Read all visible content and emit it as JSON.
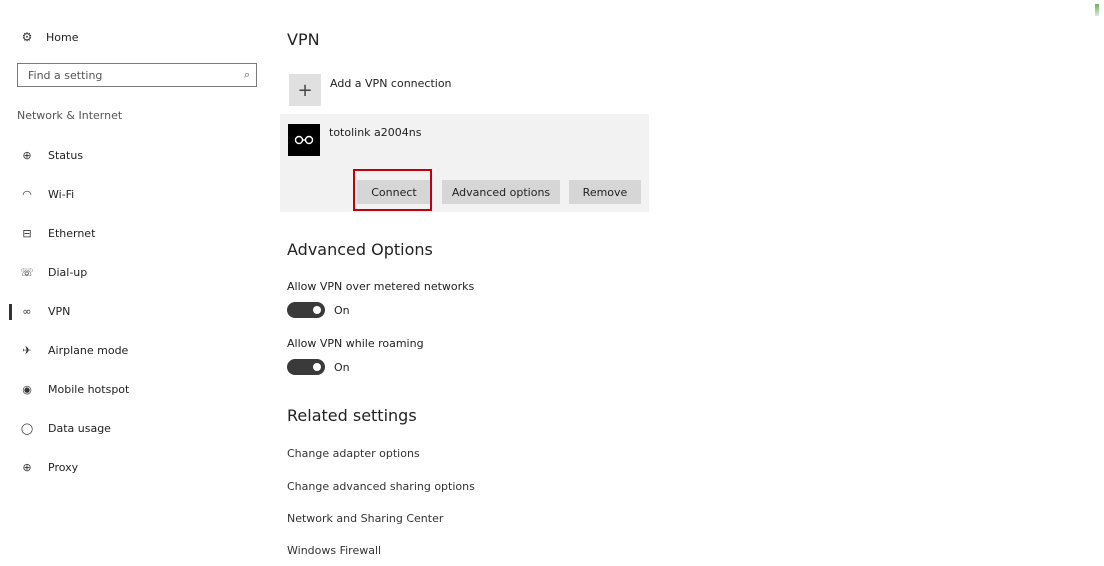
{
  "sidebar": {
    "home_label": "Home",
    "search": {
      "placeholder": "Find a setting"
    },
    "section_label": "Network & Internet",
    "items": [
      {
        "label": "Status",
        "icon": "globe-status-icon",
        "glyph": "⊕",
        "active": false
      },
      {
        "label": "Wi-Fi",
        "icon": "wifi-icon",
        "glyph": "◠",
        "active": false
      },
      {
        "label": "Ethernet",
        "icon": "ethernet-icon",
        "glyph": "⊟",
        "active": false
      },
      {
        "label": "Dial-up",
        "icon": "phone-icon",
        "glyph": "☏",
        "active": false
      },
      {
        "label": "VPN",
        "icon": "vpn-icon",
        "glyph": "∞",
        "active": true
      },
      {
        "label": "Airplane mode",
        "icon": "airplane-icon",
        "glyph": "✈",
        "active": false
      },
      {
        "label": "Mobile hotspot",
        "icon": "hotspot-icon",
        "glyph": "◉",
        "active": false
      },
      {
        "label": "Data usage",
        "icon": "data-usage-icon",
        "glyph": "◯",
        "active": false
      },
      {
        "label": "Proxy",
        "icon": "proxy-icon",
        "glyph": "⊕",
        "active": false
      }
    ]
  },
  "main": {
    "title": "VPN",
    "add_vpn_label": "Add a VPN connection",
    "connection": {
      "name": "totolink a2004ns",
      "buttons": {
        "connect": "Connect",
        "advanced": "Advanced options",
        "remove": "Remove"
      }
    },
    "advanced": {
      "title": "Advanced Options",
      "options": [
        {
          "label": "Allow VPN over metered networks",
          "state": "On"
        },
        {
          "label": "Allow VPN while roaming",
          "state": "On"
        }
      ]
    },
    "related": {
      "title": "Related settings",
      "links": [
        "Change adapter options",
        "Change advanced sharing options",
        "Network and Sharing Center",
        "Windows Firewall"
      ]
    }
  },
  "colors": {
    "highlight": "#c0000a",
    "toggle_on": "#3a3a3a",
    "card_bg": "#f2f2f2",
    "button_bg": "#d6d6d6"
  }
}
